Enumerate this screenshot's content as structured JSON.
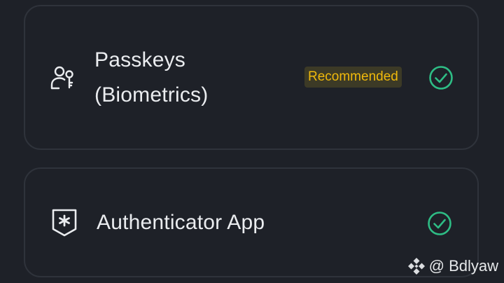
{
  "methods": [
    {
      "title_line1": "Passkeys",
      "title_line2": "(Biometrics)",
      "badge": "Recommended",
      "icon": "user-key-icon",
      "status_icon": "check-circle-icon"
    },
    {
      "title_line1": "Authenticator App",
      "icon": "authenticator-shield-icon",
      "status_icon": "check-circle-icon"
    }
  ],
  "watermark": {
    "text": "@ Bdlyaw",
    "logo": "binance-logo"
  },
  "colors": {
    "background": "#1e2128",
    "card_border": "#2f333b",
    "text": "#eaecef",
    "badge_text": "#f0b90b",
    "badge_bg": "#3c3a26",
    "check": "#2ebd85"
  }
}
